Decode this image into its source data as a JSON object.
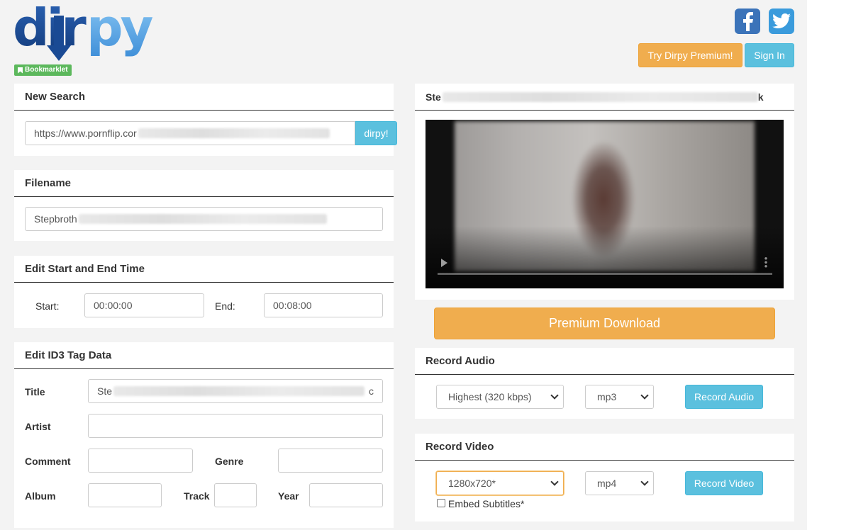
{
  "brand": {
    "name": "dirpy",
    "bookmarklet": "Bookmarklet"
  },
  "icons": {
    "facebook": "facebook-icon",
    "twitter": "twitter-icon",
    "bookmark": "bookmark-icon",
    "play": "play-icon",
    "more": "more-vertical-icon"
  },
  "colors": {
    "warning": "#f0ad4e",
    "info": "#5bc0de",
    "success": "#5cb85c",
    "brand_dark": "#1f4f9c",
    "brand_light": "#5aa7e6"
  },
  "header": {
    "premium_button": "Try Dirpy Premium!",
    "signin_button": "Sign In"
  },
  "new_search": {
    "heading": "New Search",
    "url_value": "https://www.pornflip.cor",
    "submit": "dirpy!"
  },
  "filename": {
    "heading": "Filename",
    "value": "Stepbroth"
  },
  "time": {
    "heading": "Edit Start and End Time",
    "start_label": "Start:",
    "start_value": "00:00:00",
    "end_label": "End:",
    "end_value": "00:08:00"
  },
  "id3": {
    "heading": "Edit ID3 Tag Data",
    "title_label": "Title",
    "title_value": "Ste",
    "title_tail": "c",
    "artist_label": "Artist",
    "artist_value": "",
    "comment_label": "Comment",
    "comment_value": "",
    "genre_label": "Genre",
    "genre_value": "",
    "album_label": "Album",
    "album_value": "",
    "track_label": "Track",
    "track_value": "",
    "year_label": "Year",
    "year_value": ""
  },
  "preview": {
    "title_start": "Ste",
    "title_end": "k"
  },
  "premium_download": "Premium Download",
  "record_audio": {
    "heading": "Record Audio",
    "quality": "Highest (320 kbps)",
    "format": "mp3",
    "button": "Record Audio"
  },
  "record_video": {
    "heading": "Record Video",
    "resolution": "1280x720*",
    "format": "mp4",
    "button": "Record Video",
    "subtitles_label": "Embed Subtitles*",
    "subtitles_checked": false
  }
}
